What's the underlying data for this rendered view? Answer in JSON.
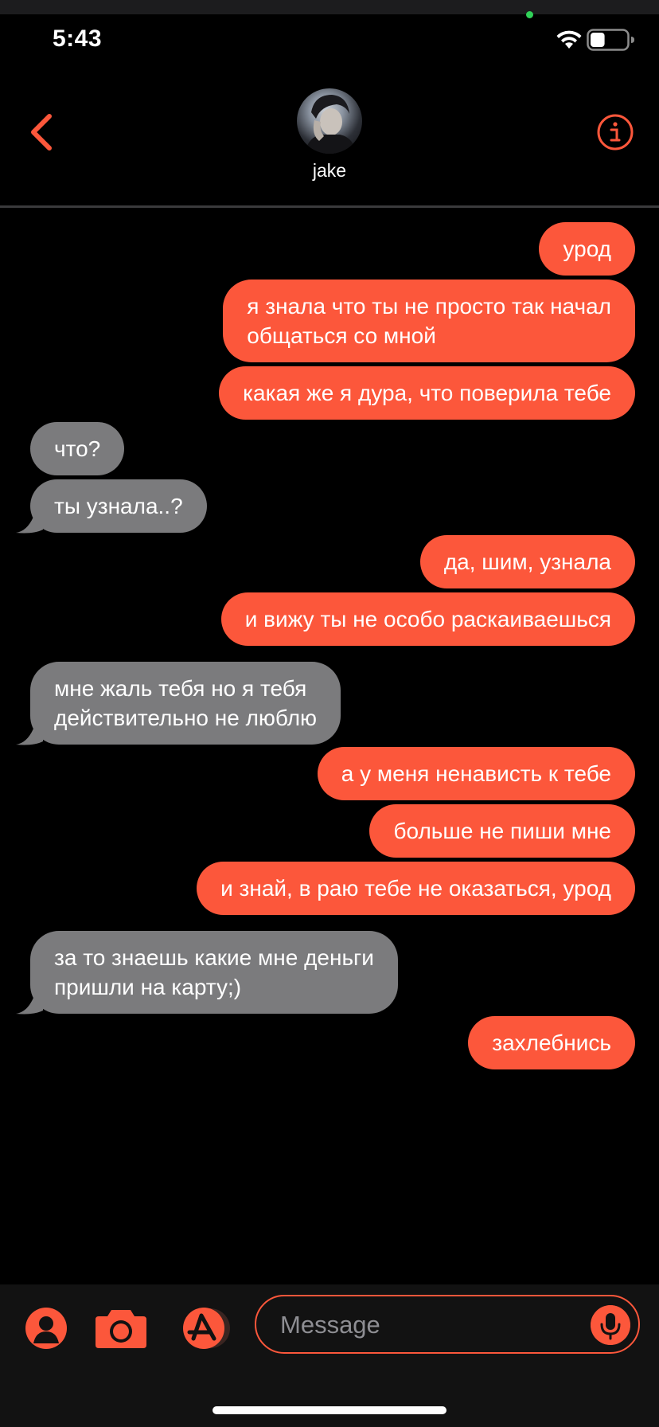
{
  "status_bar": {
    "time": "5:43",
    "battery_level": 0.4
  },
  "header": {
    "contact_name": "jake",
    "back_icon": "chevron-left-icon",
    "info_icon": "info-circle-icon"
  },
  "messages": [
    {
      "direction": "outgoing",
      "lines": [
        "урод"
      ]
    },
    {
      "direction": "outgoing",
      "lines": [
        "я знала что ты не просто так начал",
        "общаться со мной"
      ]
    },
    {
      "direction": "outgoing",
      "lines": [
        "какая же я дура, что поверила тебе"
      ]
    },
    {
      "direction": "incoming",
      "lines": [
        "что?"
      ]
    },
    {
      "direction": "incoming",
      "lines": [
        "ты узнала..?"
      ]
    },
    {
      "direction": "outgoing",
      "lines": [
        "да, шим, узнала"
      ]
    },
    {
      "direction": "outgoing",
      "lines": [
        "и вижу ты не особо раскаиваешься"
      ]
    },
    {
      "direction": "incoming",
      "lines": [
        "мне жаль тебя но я тебя",
        "действительно не люблю"
      ]
    },
    {
      "direction": "outgoing",
      "lines": [
        "а у меня ненависть к тебе"
      ]
    },
    {
      "direction": "outgoing",
      "lines": [
        "больше не пиши мне"
      ]
    },
    {
      "direction": "outgoing",
      "lines": [
        "и знай, в раю тебе не оказаться, урод"
      ]
    },
    {
      "direction": "incoming",
      "lines": [
        "за то знаешь какие мне деньги",
        "пришли на карту;)"
      ]
    },
    {
      "direction": "outgoing",
      "lines": [
        "захлебнись"
      ]
    }
  ],
  "composer": {
    "placeholder": "Message",
    "icons": [
      "person-icon",
      "camera-icon",
      "app-store-icon",
      "microphone-icon"
    ]
  },
  "colors": {
    "accent": "#fc573b",
    "incoming_bubble": "#7b7b7d",
    "background": "#000000",
    "composer_bg": "#121212"
  }
}
